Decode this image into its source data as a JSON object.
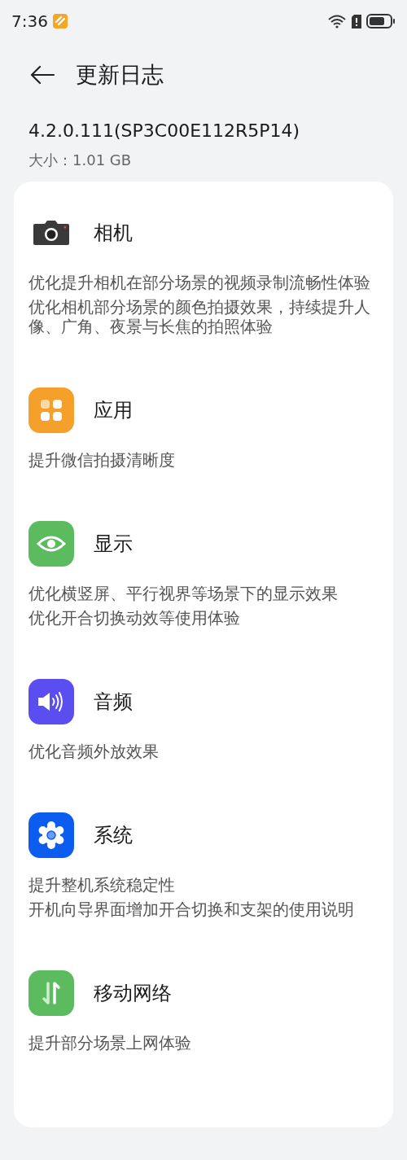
{
  "status_bar": {
    "time": "7:36"
  },
  "header": {
    "title": "更新日志"
  },
  "version": "4.2.0.111(SP3C00E112R5P14)",
  "size": "大小：1.01 GB",
  "sections": [
    {
      "kind": "camera",
      "title": "相机",
      "notes": [
        "优化提升相机在部分场景的视频录制流畅性体验",
        "优化相机部分场景的颜色拍摄效果，持续提升人像、广角、夜景与长焦的拍照体验"
      ]
    },
    {
      "kind": "apps",
      "title": "应用",
      "notes": [
        "提升微信拍摄清晰度"
      ]
    },
    {
      "kind": "display",
      "title": "显示",
      "notes": [
        "优化横竖屏、平行视界等场景下的显示效果",
        "优化开合切换动效等使用体验"
      ]
    },
    {
      "kind": "audio",
      "title": "音频",
      "notes": [
        "优化音频外放效果"
      ]
    },
    {
      "kind": "system",
      "title": "系统",
      "notes": [
        "提升整机系统稳定性",
        "开机向导界面增加开合切换和支架的使用说明"
      ]
    },
    {
      "kind": "network",
      "title": "移动网络",
      "notes": [
        "提升部分场景上网体验"
      ]
    }
  ]
}
